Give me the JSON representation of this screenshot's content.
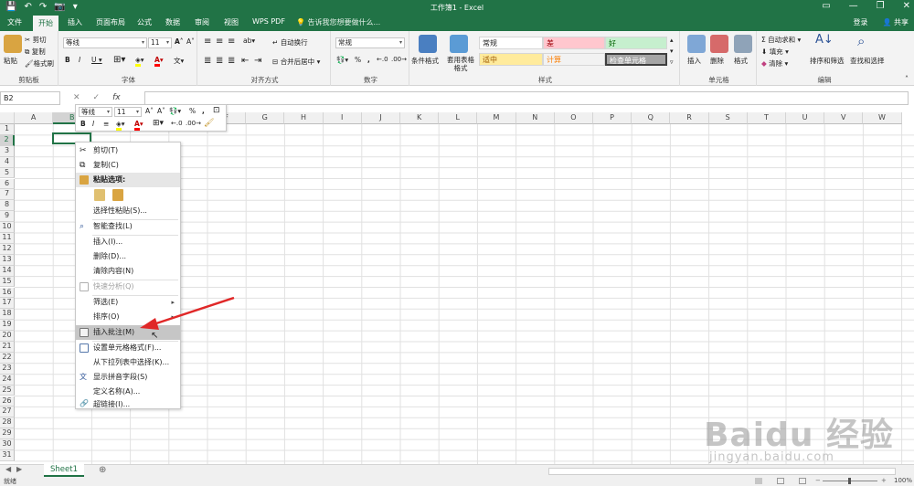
{
  "titlebar": {
    "title": "工作簿1 - Excel",
    "qat": [
      "💾",
      "↶",
      "↷",
      "📷",
      "▾"
    ]
  },
  "tabs": [
    "文件",
    "开始",
    "插入",
    "页面布局",
    "公式",
    "数据",
    "审阅",
    "视图",
    "WPS PDF"
  ],
  "tellme": "💡 告诉我您想要做什么...",
  "account": {
    "signin": "登录",
    "share": "共享"
  },
  "ribbon": {
    "clipboard": {
      "paste": "粘贴",
      "cut": "剪切",
      "copy": "复制",
      "painter": "格式刷",
      "label": "剪贴板"
    },
    "font": {
      "name": "等线",
      "size": "11",
      "label": "字体"
    },
    "alignment": {
      "wrap": "自动换行",
      "merge": "合并后居中",
      "label": "对齐方式"
    },
    "number": {
      "format": "常规",
      "label": "数字"
    },
    "styles": {
      "cond": "条件格式",
      "table": "套用表格格式",
      "cells": [
        "常规",
        "差",
        "好",
        "适中",
        "计算",
        "检查单元格"
      ],
      "label": "样式"
    },
    "cells": {
      "insert": "插入",
      "delete": "删除",
      "format": "格式",
      "label": "单元格"
    },
    "editing": {
      "autosum": "自动求和",
      "fill": "填充",
      "clear": "清除",
      "sort": "排序和筛选",
      "find": "查找和选择",
      "label": "编辑"
    }
  },
  "formulabar": {
    "namebox": "B2",
    "fx": "fx"
  },
  "columns": [
    "A",
    "B",
    "C",
    "D",
    "E",
    "F",
    "G",
    "H",
    "I",
    "J",
    "K",
    "L",
    "M",
    "N",
    "O",
    "P",
    "Q",
    "R",
    "S",
    "T",
    "U",
    "V",
    "W"
  ],
  "rows": [
    "1",
    "2",
    "3",
    "4",
    "5",
    "6",
    "7",
    "8",
    "9",
    "10",
    "11",
    "12",
    "13",
    "14",
    "15",
    "16",
    "17",
    "18",
    "19",
    "20",
    "21",
    "22",
    "23",
    "24",
    "25",
    "26",
    "27",
    "28",
    "29",
    "30",
    "31"
  ],
  "minitoolbar": {
    "font": "等线",
    "size": "11"
  },
  "contextmenu": {
    "cut": "剪切(T)",
    "copy": "复制(C)",
    "paste_options": "粘贴选项:",
    "paste_special": "选择性粘贴(S)...",
    "smart_lookup": "智能查找(L)",
    "insert": "插入(I)...",
    "delete": "删除(D)...",
    "clear": "清除内容(N)",
    "quick_analysis": "快速分析(Q)",
    "filter": "筛选(E)",
    "sort": "排序(O)",
    "insert_comment": "插入批注(M)",
    "format_cells": "设置单元格格式(F)...",
    "pick_list": "从下拉列表中选择(K)...",
    "phonetic": "显示拼音字段(S)",
    "define_name": "定义名称(A)...",
    "hyperlink": "超链接(I)..."
  },
  "sheets": [
    "Sheet1"
  ],
  "status": {
    "ready": "就绪",
    "zoom": "100%"
  },
  "watermark": {
    "brand": "Baidu 经验",
    "url": "jingyan.baidu.com"
  },
  "colors": {
    "excel_green": "#217346",
    "bad_fill": "#ffc7ce",
    "good_fill": "#c6efce",
    "neutral_fill": "#ffeb9c",
    "calc_fill": "#f2f2f2",
    "check_fill": "#a5a5a5",
    "arrow_red": "#e02828"
  }
}
